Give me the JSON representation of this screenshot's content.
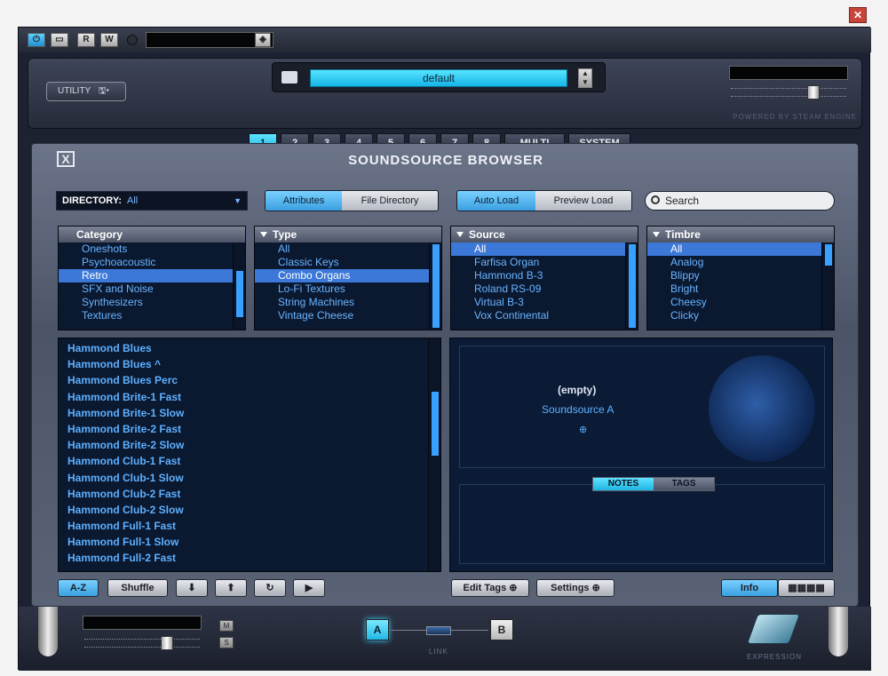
{
  "toolbar": {
    "r_label": "R",
    "w_label": "W"
  },
  "header": {
    "utility_label": "UTILITY",
    "preset_name": "default",
    "part_tabs": [
      "1",
      "2",
      "3",
      "4",
      "5",
      "6",
      "7",
      "8",
      "MULTI",
      "SYSTEM"
    ],
    "selected_part": "1",
    "powered_by": "POWERED BY STEAM ENGINE"
  },
  "browser": {
    "title": "SOUNDSOURCE BROWSER",
    "close_label": "X",
    "directory_label": "DIRECTORY:",
    "directory_value": "All",
    "view_tabs": {
      "attributes": "Attributes",
      "file_directory": "File Directory"
    },
    "load_tabs": {
      "auto_load": "Auto Load",
      "preview_load": "Preview Load"
    },
    "search_placeholder": "Search",
    "category": {
      "header": "Category",
      "items": [
        "Oneshots",
        "Psychoacoustic",
        "Retro",
        "SFX and Noise",
        "Synthesizers",
        "Textures"
      ],
      "selected": "Retro"
    },
    "type": {
      "header": "Type",
      "items": [
        "All",
        "Classic Keys",
        "Combo Organs",
        "Lo-Fi Textures",
        "String Machines",
        "Vintage Cheese"
      ],
      "selected": "Combo Organs"
    },
    "source": {
      "header": "Source",
      "items": [
        "All",
        "Farfisa Organ",
        "Hammond B-3",
        "Roland RS-09",
        "Virtual B-3",
        "Vox Continental"
      ],
      "selected": "All"
    },
    "timbre": {
      "header": "Timbre",
      "items": [
        "All",
        "Analog",
        "Blippy",
        "Bright",
        "Cheesy",
        "Clicky"
      ],
      "selected": "All"
    },
    "results": [
      "Hammond Blues",
      "Hammond Blues ^",
      "Hammond Blues Perc",
      "Hammond Brite-1 Fast",
      "Hammond Brite-1 Slow",
      "Hammond Brite-2 Fast",
      "Hammond Brite-2 Slow",
      "Hammond Club-1 Fast",
      "Hammond Club-1 Slow",
      "Hammond Club-2 Fast",
      "Hammond Club-2 Slow",
      "Hammond Full-1 Fast",
      "Hammond Full-1 Slow",
      "Hammond Full-2 Fast"
    ],
    "info": {
      "empty_label": "(empty)",
      "source_label": "Soundsource A",
      "notes_tab": "NOTES",
      "tags_tab": "TAGS"
    },
    "bottom": {
      "az": "A-Z",
      "shuffle": "Shuffle",
      "edit_tags": "Edit Tags",
      "settings": "Settings",
      "info": "Info"
    }
  },
  "footer": {
    "m": "M",
    "s": "S",
    "a": "A",
    "b": "B",
    "link": "LINK",
    "expression": "EXPRESSION"
  },
  "colors": {
    "accent": "#1fb4e0",
    "list_bg": "#0a1830",
    "list_text": "#6ab4ff",
    "selection": "#3c78d8"
  }
}
